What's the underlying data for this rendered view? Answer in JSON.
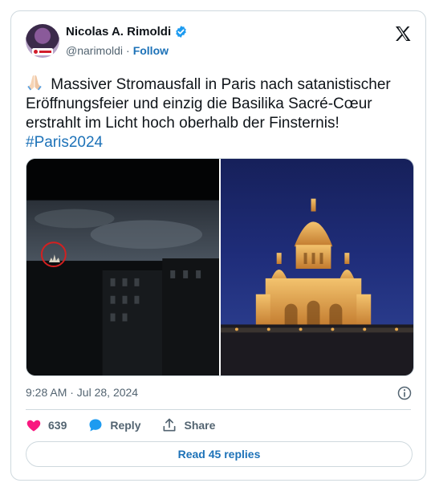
{
  "author": {
    "name": "Nicolas A. Rimoldi",
    "handle": "@narimoldi",
    "separator": "·",
    "follow_label": "Follow"
  },
  "tweet": {
    "text": "Massiver Stromausfall in Paris nach satanistischer Eröffnungsfeier und einzig die Basilika Sacré-Cœur erstrahlt im Licht hoch oberhalb der Finsternis!",
    "hashtag": "#Paris2024",
    "emoji": "folded-hands",
    "timestamp": "9:28 AM · Jul 28, 2024"
  },
  "actions": {
    "likes": "639",
    "reply_label": "Reply",
    "share_label": "Share",
    "read_replies_label": "Read 45 replies"
  },
  "icons": {
    "verified": "verified-badge-icon",
    "platform": "x-logo-icon",
    "info": "info-icon",
    "like": "heart-icon",
    "reply": "reply-bubble-icon",
    "share": "share-upload-icon"
  },
  "colors": {
    "accent": "#1d72b8",
    "like": "#f91880",
    "verified": "#1d9bf0",
    "muted": "#536471",
    "border": "#cfd9de"
  }
}
